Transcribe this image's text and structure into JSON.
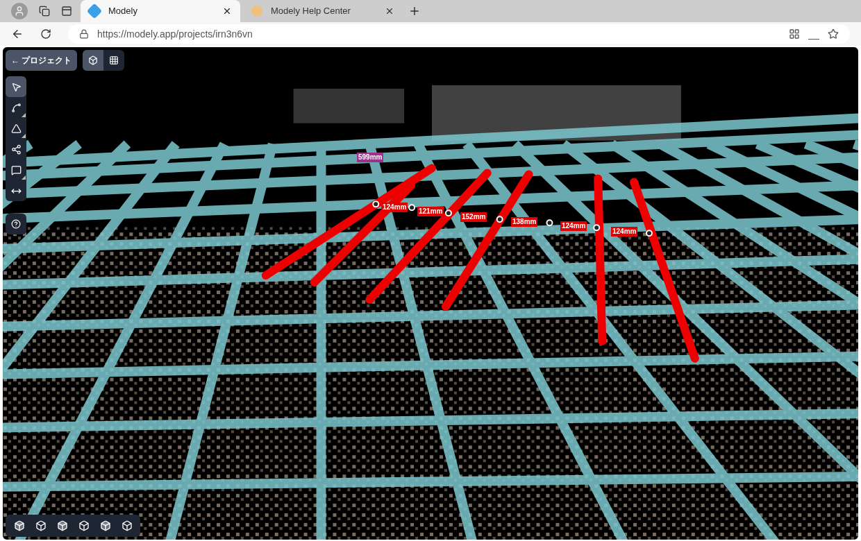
{
  "browser": {
    "tabs": [
      {
        "title": "Modely",
        "selected": true
      },
      {
        "title": "Modely Help Center",
        "selected": false
      }
    ],
    "url": "https://modely.app/projects/irn3n6vn"
  },
  "back_button": {
    "label": "← プロジェクト"
  },
  "view_toggle": [
    {
      "selected": true
    },
    {
      "selected": false
    }
  ],
  "tools": [
    {
      "selected": true,
      "submenu": false
    },
    {
      "selected": false,
      "submenu": true
    },
    {
      "selected": false,
      "submenu": true
    },
    {
      "selected": false,
      "submenu": false
    },
    {
      "selected": false,
      "submenu": true
    },
    {
      "selected": false,
      "submenu": false
    }
  ],
  "measurements": [
    {
      "label": "599mm",
      "color": "#a0308c"
    },
    {
      "label": "124mm",
      "color": "#e00000"
    },
    {
      "label": "121mm",
      "color": "#e00000"
    },
    {
      "label": "152mm",
      "color": "#e00000"
    },
    {
      "label": "138mm",
      "color": "#e00000"
    },
    {
      "label": "124mm",
      "color": "#e00000"
    },
    {
      "label": "124mm",
      "color": "#e00000"
    }
  ]
}
